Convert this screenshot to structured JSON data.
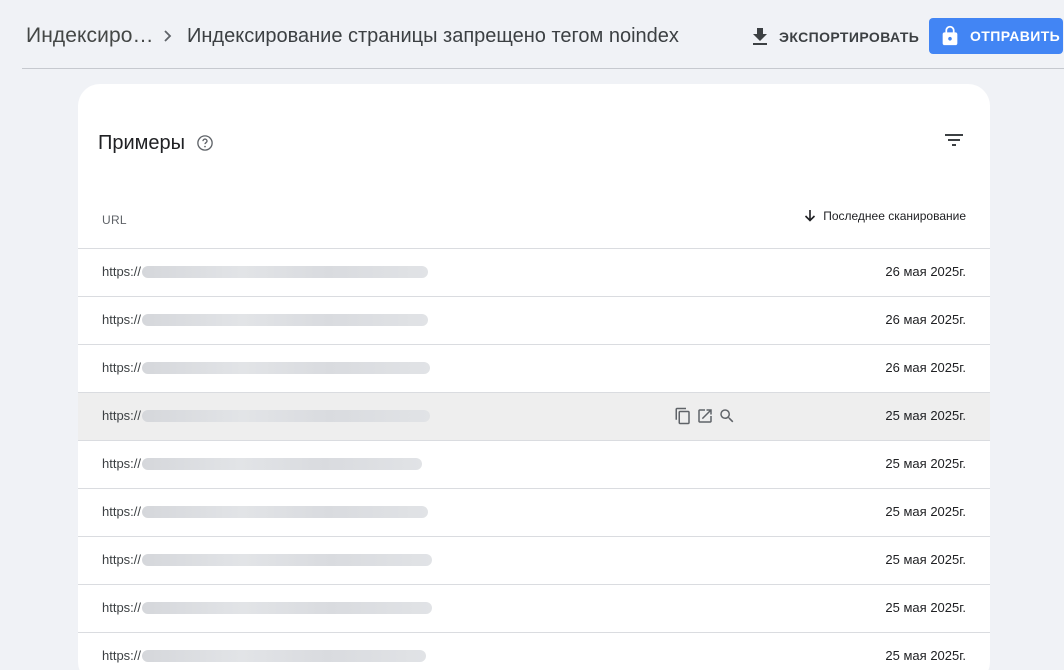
{
  "breadcrumb": {
    "parent": "Индексиро…",
    "current": "Индексирование страницы запрещено тегом noindex"
  },
  "actions": {
    "export_label": "ЭКСПОРТИРОВАТЬ",
    "submit_label": "ОТПРАВИТЬ"
  },
  "card": {
    "title": "Примеры"
  },
  "table": {
    "columns": [
      "URL",
      "Последнее сканирование"
    ],
    "rows": [
      {
        "url": "https://",
        "date": "26 мая 2025г."
      },
      {
        "url": "https://",
        "date": "26 мая 2025г."
      },
      {
        "url": "https://",
        "date": "26 мая 2025г."
      },
      {
        "url": "https://",
        "date": "25 мая 2025г."
      },
      {
        "url": "https://",
        "date": "25 мая 2025г."
      },
      {
        "url": "https://",
        "date": "25 мая 2025г."
      },
      {
        "url": "https://",
        "date": "25 мая 2025г."
      },
      {
        "url": "https://",
        "date": "25 мая 2025г."
      },
      {
        "url": "https://",
        "date": "25 мая 2025г."
      }
    ],
    "hovered_row": 4
  },
  "colors": {
    "accent": "#4285f4",
    "background": "#f0f2f6",
    "card": "#ffffff",
    "hover_row": "#eeeeee"
  },
  "icons": {
    "breadcrumb_separator": "chevron-right-icon",
    "export": "download-icon",
    "submit": "lock-icon",
    "help": "help-circle-icon",
    "filter": "filter-icon",
    "sort": "arrow-down-icon",
    "row_actions": [
      "copy-icon",
      "open-in-new-icon",
      "search-icon"
    ]
  }
}
